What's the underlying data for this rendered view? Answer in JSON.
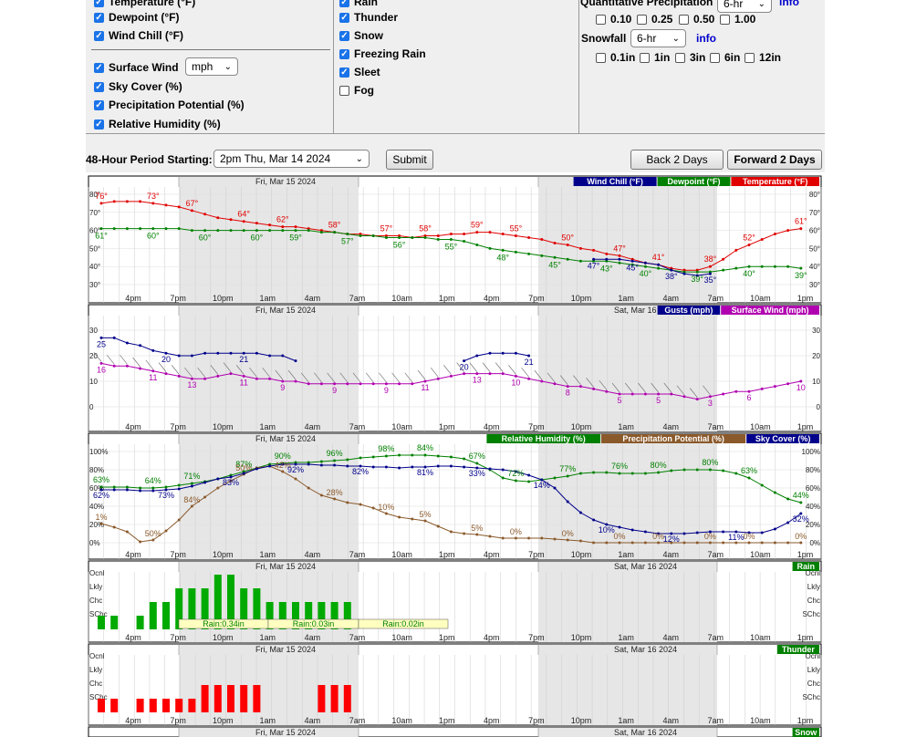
{
  "form": {
    "col1": [
      {
        "label": "Temperature (°F)",
        "checked": true
      },
      {
        "label": "Dewpoint (°F)",
        "checked": true
      },
      {
        "label": "Wind Chill (°F)",
        "checked": true
      },
      {
        "label": "Surface Wind",
        "checked": true
      },
      {
        "label": "Sky Cover (%)",
        "checked": true
      },
      {
        "label": "Precipitation Potential (%)",
        "checked": true
      },
      {
        "label": "Relative Humidity (%)",
        "checked": true
      }
    ],
    "wind_unit": "mph",
    "col2": [
      {
        "label": "Rain",
        "checked": true
      },
      {
        "label": "Thunder",
        "checked": true
      },
      {
        "label": "Snow",
        "checked": true
      },
      {
        "label": "Freezing Rain",
        "checked": true
      },
      {
        "label": "Sleet",
        "checked": true
      },
      {
        "label": "Fog",
        "checked": false
      }
    ],
    "qpf_label": "Quantitative Precipitation",
    "qpf_select": "6-hr",
    "info": "info",
    "qpf_options": [
      "0.10",
      "0.25",
      "0.50",
      "1.00"
    ],
    "snowfall_label": "Snowfall",
    "snowfall_select": "6-hr",
    "snow_options": [
      "0.1in",
      "1in",
      "3in",
      "6in",
      "12in"
    ]
  },
  "period": {
    "label": "48-Hour Period Starting:",
    "select": "2pm Thu, Mar 14 2024",
    "submit": "Submit",
    "back": "Back 2 Days",
    "forward": "Forward 2 Days"
  },
  "chart_data": [
    {
      "type": "line",
      "panel": "temperature",
      "date_labels": [
        "Fri, Mar 15 2024"
      ],
      "legend": [
        "Wind Chill (°F)",
        "Dewpoint (°F)",
        "Temperature (°F)"
      ],
      "ylim": [
        30,
        80
      ],
      "y_ticks": [
        "80°",
        "70°",
        "60°",
        "50°",
        "40°",
        "30°"
      ],
      "x_labels": [
        "4pm",
        "7pm",
        "10pm",
        "1am",
        "4am",
        "7am",
        "10am",
        "1pm",
        "4pm",
        "7pm",
        "10pm",
        "1am",
        "4am",
        "7am",
        "10am",
        "1pm"
      ],
      "series": [
        {
          "name": "Temperature (°F)",
          "color": "#e00000",
          "values": [
            75,
            76,
            76,
            76,
            75,
            74,
            73,
            71,
            69,
            67,
            66,
            65,
            64,
            63,
            62,
            62,
            61,
            60,
            59,
            58,
            58,
            57,
            57,
            57,
            56,
            57,
            57,
            58,
            58,
            59,
            59,
            58,
            57,
            56,
            55,
            53,
            52,
            50,
            49,
            47,
            46,
            44,
            42,
            41,
            39,
            38,
            38,
            40,
            44,
            49,
            52,
            55,
            58,
            60,
            61
          ]
        },
        {
          "name": "Dewpoint (°F)",
          "color": "#008000",
          "values": [
            61,
            61,
            61,
            61,
            61,
            61,
            61,
            60,
            60,
            60,
            60,
            60,
            60,
            60,
            60,
            60,
            60,
            59,
            59,
            58,
            57,
            57,
            56,
            56,
            56,
            56,
            55,
            55,
            54,
            52,
            50,
            49,
            48,
            47,
            46,
            45,
            44,
            43,
            43,
            43,
            42,
            41,
            40,
            39,
            38,
            37,
            37,
            37,
            38,
            39,
            40,
            40,
            40,
            40,
            39
          ]
        },
        {
          "name": "Wind Chill (°F)",
          "color": "#00008b",
          "values": [
            null,
            null,
            null,
            null,
            null,
            null,
            null,
            null,
            null,
            null,
            null,
            null,
            null,
            null,
            null,
            null,
            null,
            null,
            null,
            null,
            null,
            null,
            null,
            null,
            null,
            null,
            null,
            null,
            null,
            null,
            null,
            null,
            null,
            null,
            null,
            null,
            null,
            null,
            44,
            44,
            44,
            43,
            42,
            41,
            38,
            36,
            35,
            36,
            null,
            null,
            null,
            null,
            null,
            null,
            null
          ]
        }
      ],
      "data_labels": {
        "temperature": [
          "76°",
          "73°",
          "67°",
          "64°",
          "62°",
          "58°",
          "57°",
          "58°",
          "59°",
          "55°",
          "50°",
          "47°",
          "41°",
          "38°",
          "52°",
          "61°"
        ],
        "dewpoint": [
          "61°",
          "60°",
          "60°",
          "60°",
          "59°",
          "57°",
          "56°",
          "55°",
          "48°",
          "45°",
          "43°",
          "40°",
          "39°",
          "40°",
          "39°"
        ],
        "windchill": [
          "47°",
          "45°",
          "38°",
          "35°"
        ]
      }
    },
    {
      "type": "line",
      "panel": "wind",
      "date_labels": [
        "Fri, Mar 15 2024",
        "Sat, Mar 16"
      ],
      "legend": [
        "Gusts (mph)",
        "Surface Wind (mph)"
      ],
      "ylim": [
        0,
        30
      ],
      "y_ticks": [
        "30",
        "20",
        "10",
        "0"
      ],
      "x_labels": [
        "4pm",
        "7pm",
        "10pm",
        "1am",
        "4am",
        "7am",
        "10am",
        "1pm",
        "4pm",
        "7pm",
        "10pm",
        "1am",
        "4am",
        "7am",
        "10am",
        "1pm"
      ],
      "series": [
        {
          "name": "Gusts (mph)",
          "color": "#00008b",
          "values": [
            27,
            27,
            25,
            24,
            22,
            21,
            20,
            20,
            21,
            21,
            21,
            21,
            21,
            20,
            20,
            18,
            null,
            null,
            null,
            null,
            null,
            null,
            null,
            null,
            null,
            null,
            null,
            null,
            18,
            20,
            21,
            21,
            21,
            20,
            null
          ]
        },
        {
          "name": "Surface Wind (mph)",
          "color": "#b000b0",
          "values": [
            17,
            16,
            16,
            15,
            14,
            13,
            12,
            11,
            11,
            12,
            13,
            12,
            11,
            11,
            10,
            10,
            9,
            9,
            9,
            9,
            9,
            9,
            9,
            9,
            9,
            10,
            11,
            12,
            13,
            13,
            13,
            13,
            12,
            11,
            10,
            9,
            8,
            8,
            7,
            6,
            5,
            5,
            5,
            5,
            5,
            4,
            3,
            4,
            5,
            6,
            6,
            7,
            8,
            9,
            10
          ]
        }
      ],
      "data_labels": {
        "gusts": [
          "25",
          "20",
          "21",
          "20",
          "21"
        ],
        "wind": [
          "16",
          "11",
          "13",
          "11",
          "9",
          "9",
          "9",
          "11",
          "13",
          "10",
          "8",
          "5",
          "5",
          "3",
          "6",
          "10"
        ]
      }
    },
    {
      "type": "line",
      "panel": "humidity",
      "date_labels": [
        "Fri, Mar 15 2024"
      ],
      "legend": [
        "Relative Humidity (%)",
        "Precipitation Potential (%)",
        "Sky Cover (%)"
      ],
      "ylim": [
        0,
        100
      ],
      "y_ticks": [
        "100%",
        "80%",
        "60%",
        "40%",
        "20%",
        "0%"
      ],
      "x_labels": [
        "4pm",
        "7pm",
        "10pm",
        "1am",
        "4am",
        "7am",
        "10am",
        "1pm",
        "4pm",
        "7pm",
        "10pm",
        "1am",
        "4am",
        "7am",
        "10am",
        "1pm"
      ],
      "series": [
        {
          "name": "Relative Humidity (%)",
          "color": "#008000",
          "values": [
            61,
            61,
            61,
            60,
            60,
            61,
            63,
            65,
            67,
            70,
            74,
            78,
            82,
            86,
            87,
            88,
            88,
            89,
            90,
            91,
            93,
            94,
            95,
            96,
            96,
            96,
            95,
            94,
            92,
            87,
            80,
            71,
            68,
            67,
            69,
            71,
            73,
            76,
            77,
            77,
            76,
            76,
            76,
            77,
            79,
            80,
            80,
            80,
            79,
            76,
            71,
            63,
            55,
            48,
            44
          ]
        },
        {
          "name": "Precipitation Potential (%)",
          "color": "#8b5a2b",
          "values": [
            21,
            17,
            12,
            1,
            3,
            13,
            25,
            40,
            50,
            60,
            68,
            75,
            82,
            84,
            78,
            70,
            60,
            52,
            48,
            44,
            42,
            38,
            32,
            28,
            26,
            24,
            18,
            12,
            10,
            9,
            7,
            5,
            5,
            5,
            5,
            4,
            3,
            2,
            0,
            0,
            0,
            0,
            0,
            0,
            0,
            0,
            0,
            0,
            0,
            0,
            0,
            0,
            0,
            0,
            0
          ]
        },
        {
          "name": "Sky Cover (%)",
          "color": "#00008b",
          "values": [
            58,
            58,
            58,
            57,
            57,
            58,
            59,
            62,
            66,
            70,
            72,
            76,
            81,
            84,
            86,
            86,
            86,
            85,
            85,
            84,
            84,
            83,
            83,
            82,
            83,
            83,
            84,
            84,
            83,
            82,
            81,
            80,
            78,
            74,
            69,
            60,
            45,
            33,
            25,
            20,
            17,
            14,
            12,
            10,
            10,
            10,
            11,
            12,
            12,
            12,
            11,
            11,
            15,
            22,
            32
          ]
        }
      ],
      "data_labels": {
        "rh": [
          "63%",
          "64%",
          "71%",
          "87%",
          "90%",
          "96%",
          "98%",
          "84%",
          "67%",
          "72%",
          "77%",
          "76%",
          "80%",
          "80%",
          "63%",
          "44%"
        ],
        "pop": [
          "1%",
          "50%",
          "84%",
          "50%",
          "42%",
          "28%",
          "10%",
          "5%",
          "5%",
          "0%",
          "0%",
          "0%",
          "0%",
          "0%",
          "0%",
          "0%"
        ],
        "sky": [
          "62%",
          "73%",
          "83%",
          "92%",
          "82%",
          "81%",
          "33%",
          "14%",
          "10%",
          "12%",
          "11%",
          "32%"
        ]
      }
    },
    {
      "type": "bar",
      "panel": "rain",
      "date_labels": [
        "Fri, Mar 15 2024",
        "Sat, Mar 16 2024"
      ],
      "legend": [
        "Rain"
      ],
      "y_ticks": [
        "Ocnl",
        "Lkly",
        "Chc",
        "SChc"
      ],
      "x_labels": [
        "4pm",
        "7pm",
        "10pm",
        "1am",
        "4am",
        "7am",
        "10am",
        "1pm",
        "4pm",
        "7pm",
        "10pm",
        "1am",
        "4am",
        "7am",
        "10am",
        "1pm"
      ],
      "qpf_labels": [
        "Rain:0.34in",
        "Rain:0.03in",
        "Rain:0.02in"
      ],
      "values": [
        1,
        1,
        0,
        1,
        2,
        2,
        3,
        3,
        3,
        4,
        4,
        3,
        3,
        2,
        2,
        2,
        2,
        2,
        2,
        2,
        0,
        0,
        0,
        0,
        0,
        0,
        0,
        0,
        0,
        0,
        0,
        0,
        0,
        0,
        0,
        0,
        0,
        0,
        0,
        0,
        0,
        0,
        0,
        0,
        0,
        0,
        0,
        0,
        0
      ]
    },
    {
      "type": "bar",
      "panel": "thunder",
      "date_labels": [
        "Fri, Mar 15 2024",
        "Sat, Mar 16 2024"
      ],
      "legend": [
        "Thunder"
      ],
      "y_ticks": [
        "Ocnl",
        "Lkly",
        "Chc",
        "SChc"
      ],
      "x_labels": [
        "4pm",
        "7pm",
        "10pm",
        "1am",
        "4am",
        "7am",
        "10am",
        "1pm",
        "4pm",
        "7pm",
        "10pm",
        "1am",
        "4am",
        "7am",
        "10am",
        "1pm"
      ],
      "values": [
        1,
        1,
        0,
        1,
        1,
        1,
        1,
        1,
        2,
        2,
        2,
        2,
        2,
        0,
        0,
        0,
        0,
        2,
        2,
        2,
        0,
        0,
        0,
        0,
        0,
        0,
        0,
        0,
        0,
        0,
        0,
        0,
        0,
        0,
        0,
        0,
        0,
        0,
        0,
        0,
        0,
        0,
        0,
        0,
        0,
        0,
        0,
        0,
        0
      ]
    },
    {
      "type": "bar",
      "panel": "snow",
      "date_labels": [
        "Fri, Mar 15 2024",
        "Sat, Mar 16 2024"
      ],
      "legend": [
        "Snow"
      ],
      "values": []
    }
  ]
}
